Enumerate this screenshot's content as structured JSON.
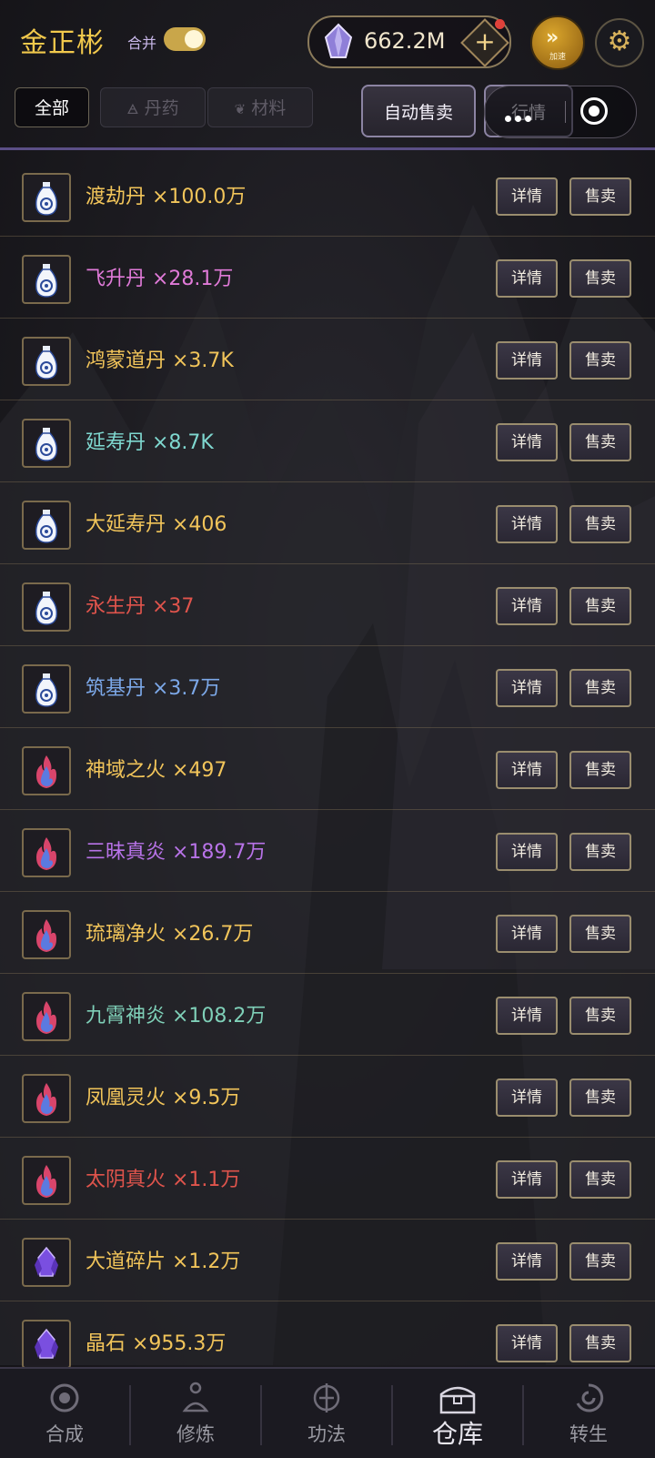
{
  "header": {
    "player_name": "金正彬",
    "merge_label": "合并",
    "merge_on": true,
    "currency_value": "662.2M",
    "plus_label": "+",
    "speed_label": "加速",
    "speed_icon": "»",
    "settings_icon": "⚙"
  },
  "filters": {
    "all": "全部",
    "pills": "丹药",
    "materials": "材料",
    "auto_sell": "自动售卖",
    "market": "行情"
  },
  "items": [
    {
      "label": "渡劫丹 ×100.0万",
      "color": "#f2c55a",
      "icon": "vase-icon"
    },
    {
      "label": "飞升丹 ×28.1万",
      "color": "#e07ad8",
      "icon": "vase-icon"
    },
    {
      "label": "鸿蒙道丹 ×3.7K",
      "color": "#f2c55a",
      "icon": "vase-icon"
    },
    {
      "label": "延寿丹 ×8.7K",
      "color": "#7fd8d0",
      "icon": "vase-icon"
    },
    {
      "label": "大延寿丹 ×406",
      "color": "#f2c55a",
      "icon": "vase-icon"
    },
    {
      "label": "永生丹 ×37",
      "color": "#e0544c",
      "icon": "vase-icon"
    },
    {
      "label": "筑基丹 ×3.7万",
      "color": "#7ca8e8",
      "icon": "vase-icon"
    },
    {
      "label": "神域之火 ×497",
      "color": "#f2c55a",
      "icon": "flame-icon"
    },
    {
      "label": "三昧真炎 ×189.7万",
      "color": "#b873e8",
      "icon": "flame-icon"
    },
    {
      "label": "琉璃净火 ×26.7万",
      "color": "#f2c55a",
      "icon": "flame-icon"
    },
    {
      "label": "九霄神炎 ×108.2万",
      "color": "#7fd0b8",
      "icon": "flame-icon"
    },
    {
      "label": "凤凰灵火 ×9.5万",
      "color": "#f2c55a",
      "icon": "flame-icon"
    },
    {
      "label": "太阴真火 ×1.1万",
      "color": "#e0544c",
      "icon": "flame-icon"
    },
    {
      "label": "大道碎片 ×1.2万",
      "color": "#f2c55a",
      "icon": "crystal-icon"
    },
    {
      "label": "晶石 ×955.3万",
      "color": "#f2c55a",
      "icon": "crystal-icon"
    }
  ],
  "actions": {
    "detail": "详情",
    "sell": "售卖"
  },
  "nav": [
    {
      "label": "合成",
      "icon": "synthesis-icon"
    },
    {
      "label": "修炼",
      "icon": "meditation-icon"
    },
    {
      "label": "功法",
      "icon": "technique-icon"
    },
    {
      "label": "仓库",
      "icon": "chest-icon"
    },
    {
      "label": "转生",
      "icon": "rebirth-icon"
    }
  ],
  "nav_active": "仓库"
}
